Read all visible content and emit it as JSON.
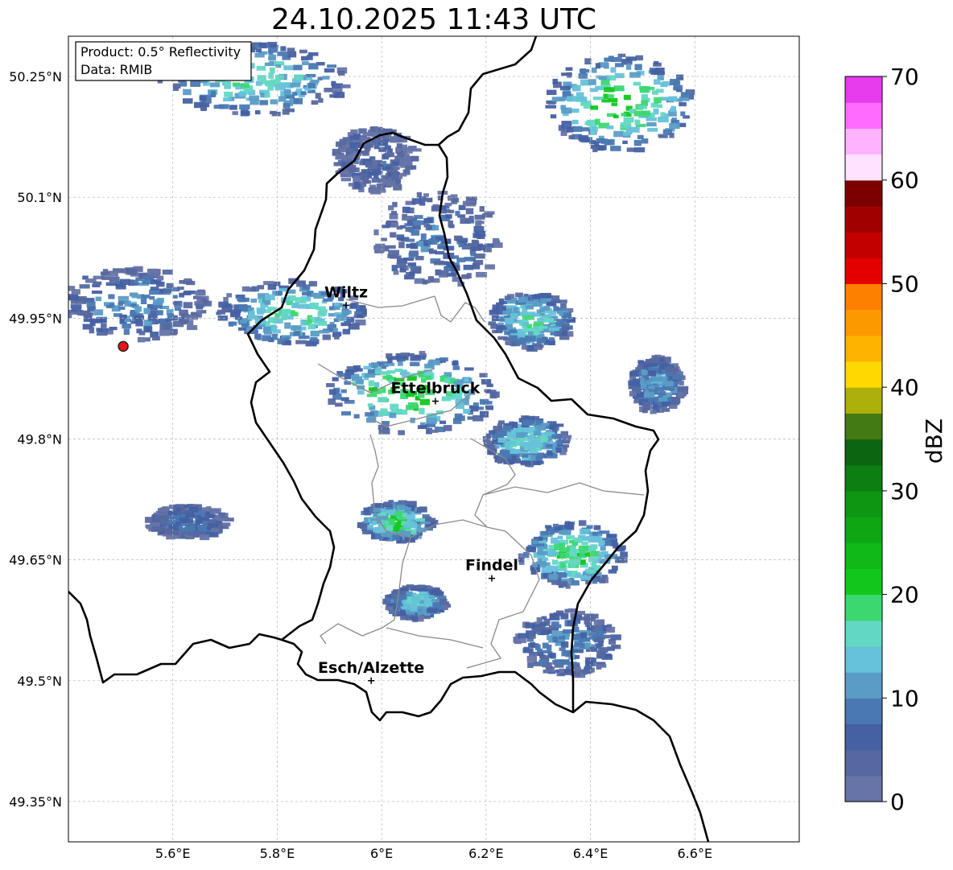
{
  "title": "24.10.2025 11:43 UTC",
  "info_box": {
    "product": "Product: 0.5° Reflectivity",
    "data": "Data: RMIB"
  },
  "map": {
    "lon_range": [
      5.4,
      6.8
    ],
    "lat_range": [
      49.3,
      50.3
    ],
    "lon_ticks": [
      {
        "value": 5.6,
        "label": "5.6°E"
      },
      {
        "value": 5.8,
        "label": "5.8°E"
      },
      {
        "value": 6.0,
        "label": "6°E"
      },
      {
        "value": 6.2,
        "label": "6.2°E"
      },
      {
        "value": 6.4,
        "label": "6.4°E"
      },
      {
        "value": 6.6,
        "label": "6.6°E"
      }
    ],
    "lat_ticks": [
      {
        "value": 49.35,
        "label": "49.35°N"
      },
      {
        "value": 49.5,
        "label": "49.5°N"
      },
      {
        "value": 49.65,
        "label": "49.65°N"
      },
      {
        "value": 49.8,
        "label": "49.8°N"
      },
      {
        "value": 49.95,
        "label": "49.95°N"
      },
      {
        "value": 50.1,
        "label": "50.1°N"
      },
      {
        "value": 50.25,
        "label": "50.25°N"
      }
    ],
    "grid": true,
    "radar_site": {
      "lon": 5.505,
      "lat": 49.915
    },
    "cities": [
      {
        "name": "Wiltz",
        "lon": 5.932,
        "lat": 49.966
      },
      {
        "name": "Ettelbruck",
        "lon": 6.103,
        "lat": 49.847
      },
      {
        "name": "Findel",
        "lon": 6.211,
        "lat": 49.627
      },
      {
        "name": "Esch/Alzette",
        "lon": 5.98,
        "lat": 49.5
      }
    ]
  },
  "colorbar": {
    "label": "dBZ",
    "range": [
      0,
      70
    ],
    "step": 2.5,
    "tick_labels": [
      "0",
      "10",
      "20",
      "30",
      "40",
      "50",
      "60",
      "70"
    ],
    "colors": [
      "#6674a8",
      "#56689f",
      "#4560a3",
      "#4a78b2",
      "#5a9cc6",
      "#66c1da",
      "#62d8c4",
      "#3dd772",
      "#12c71c",
      "#10b818",
      "#0fa614",
      "#0e9613",
      "#0d7f12",
      "#0c6611",
      "#437a13",
      "#adaf0a",
      "#fed800",
      "#fdb300",
      "#fd9900",
      "#fe8000",
      "#e50000",
      "#c30000",
      "#a00000",
      "#7d0000",
      "#ffe2ff",
      "#ffb3ff",
      "#ff6bff",
      "#e63ced"
    ]
  }
}
